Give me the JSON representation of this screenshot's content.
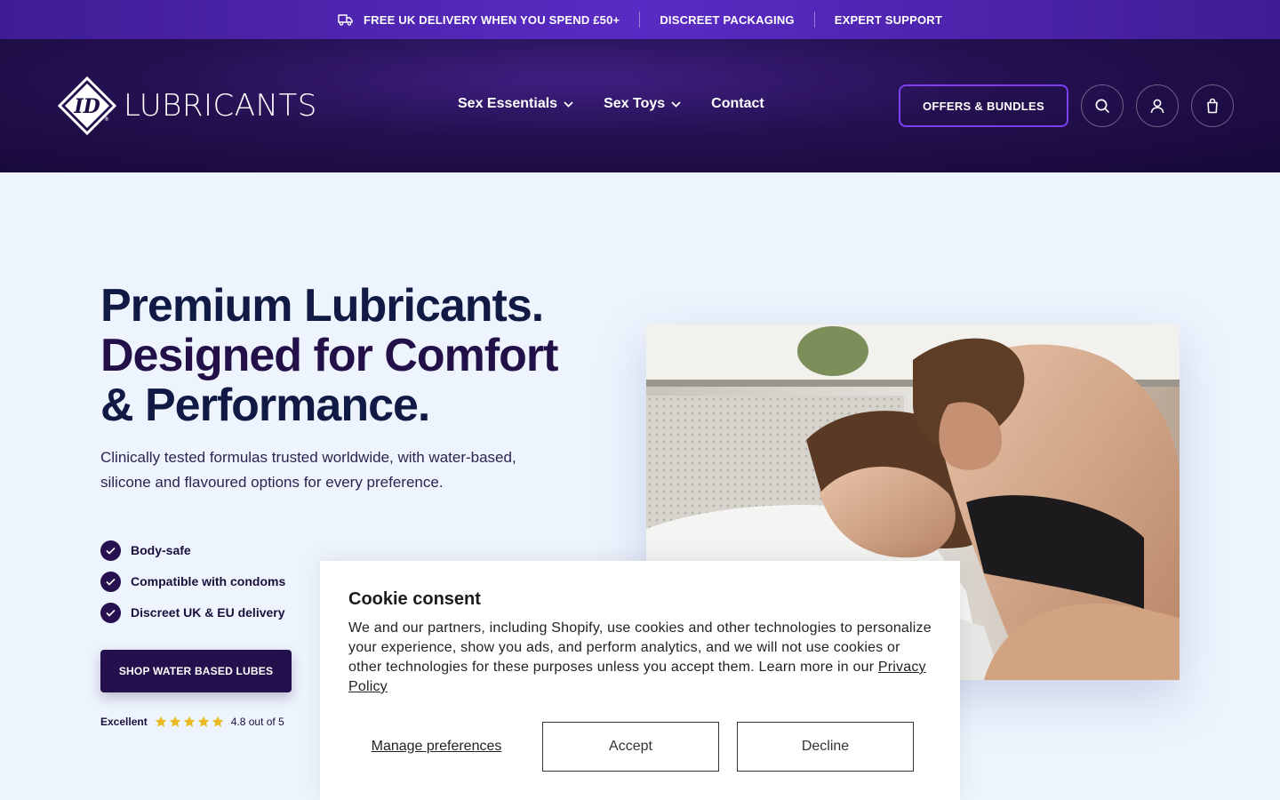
{
  "topbar": {
    "items": [
      "FREE UK DELIVERY WHEN YOU SPEND £50+",
      "DISCREET PACKAGING",
      "EXPERT SUPPORT"
    ],
    "icon": "truck-icon"
  },
  "header": {
    "logo_text": "LUBRICANTS",
    "logo_mark": "ID",
    "nav": [
      {
        "label": "Sex Essentials",
        "has_dropdown": true
      },
      {
        "label": "Sex Toys",
        "has_dropdown": true
      },
      {
        "label": "Contact",
        "has_dropdown": false
      }
    ],
    "offers_label": "OFFERS & BUNDLES",
    "icons": [
      "search-icon",
      "account-icon",
      "cart-icon"
    ]
  },
  "hero": {
    "title_line1": "Premium Lubricants.",
    "title_line2": "Designed for Comfort",
    "title_line3": "& Performance.",
    "subtitle": "Clinically tested formulas trusted worldwide, with water-based, silicone and flavoured options for every preference.",
    "checks": [
      "Body-safe",
      "Compatible with condoms",
      "Discreet UK & EU delivery"
    ],
    "cta_label": "SHOP WATER BASED LUBES",
    "rating": {
      "label": "Excellent",
      "score_text": "4.8 out of 5",
      "score": 4.8,
      "max": 5
    }
  },
  "cookie": {
    "title": "Cookie consent",
    "body": "We and our partners, including Shopify, use cookies and other technologies to personalize your experience, show you ads, and perform analytics, and we will not use cookies or other technologies for these purposes unless you accept them. Learn more in our ",
    "privacy_link": "Privacy Policy",
    "manage_label": "Manage preferences",
    "accept_label": "Accept",
    "decline_label": "Decline"
  },
  "colors": {
    "topbar": "#4a21ad",
    "header": "#1c0b45",
    "accent": "#7c3ff2",
    "cta": "#24104c",
    "star": "#e8b923"
  }
}
